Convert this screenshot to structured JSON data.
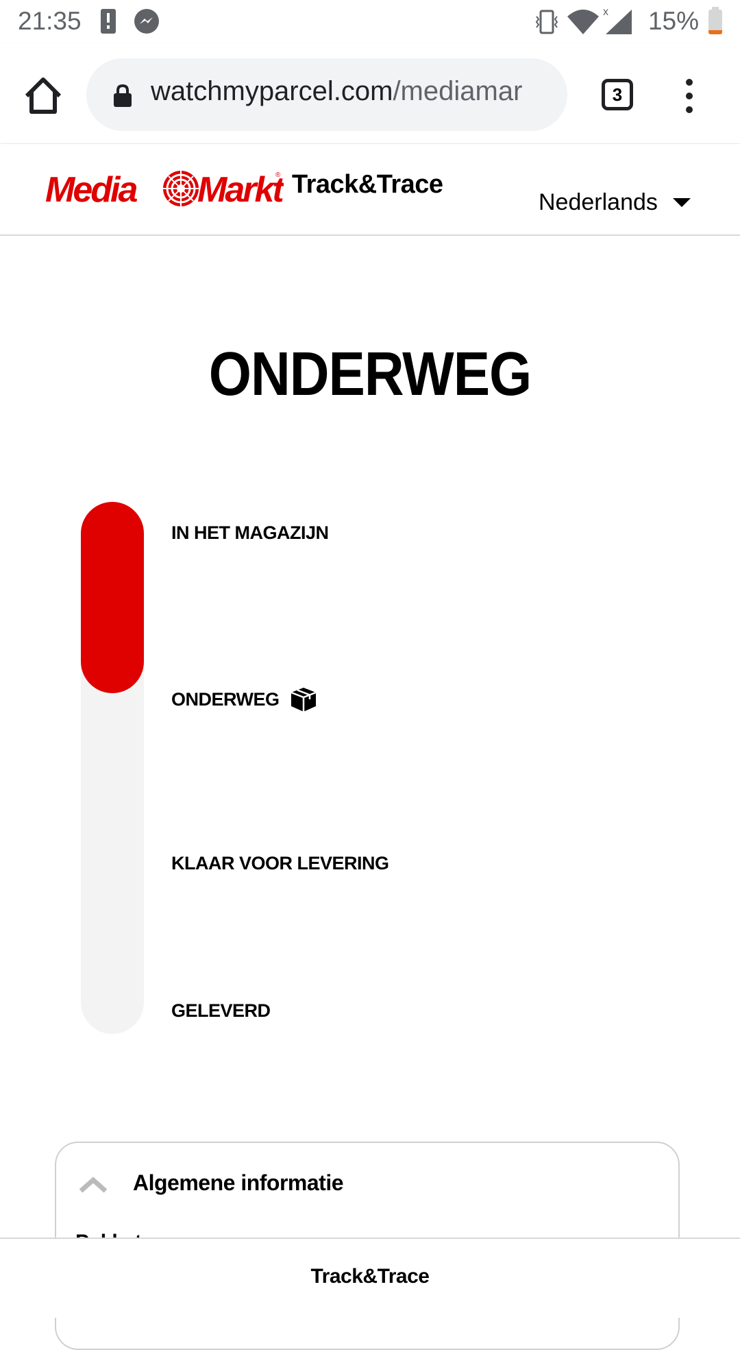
{
  "status_bar": {
    "time": "21:35",
    "battery": "15%",
    "battery_color": "#e8701a",
    "icons": [
      "alert-icon",
      "messenger-icon",
      "vibrate-icon",
      "wifi-icon",
      "signal-icon",
      "battery-icon"
    ]
  },
  "browser": {
    "url_main": "watchmyparcel.com",
    "url_path": "/mediamar",
    "tab_count": "3",
    "icons": [
      "home-icon",
      "lock-icon",
      "tabs-icon",
      "more-vert-icon"
    ]
  },
  "header": {
    "logo_text": "MediaMarkt",
    "title": "Track&Trace",
    "language": "Nederlands",
    "brand_color": "#df0000"
  },
  "main": {
    "status_title": "ONDERWEG",
    "progress_fraction": 0.36,
    "steps": [
      {
        "label": "IN HET MAGAZIJN"
      },
      {
        "label": "ONDERWEG",
        "icon": "package-icon"
      },
      {
        "label": "KLAAR VOOR LEVERING"
      },
      {
        "label": "GELEVERD"
      }
    ]
  },
  "card": {
    "title": "Algemene informatie",
    "subtitle": "Pakket"
  },
  "footer": {
    "title": "Track&Trace"
  }
}
